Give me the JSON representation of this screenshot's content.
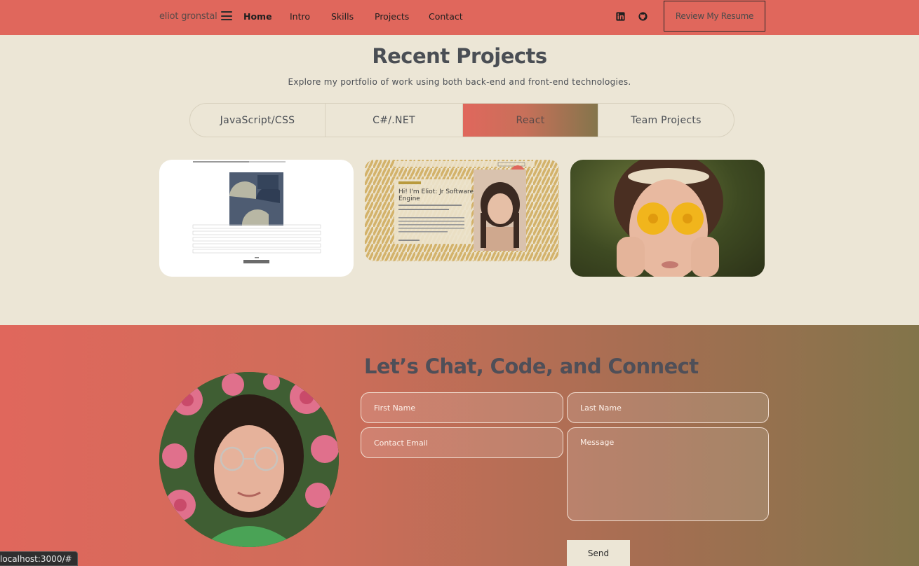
{
  "nav": {
    "brand": "eliot gronstal",
    "links": [
      "Home",
      "Intro",
      "Skills",
      "Projects",
      "Contact"
    ],
    "active": "Home",
    "icons": [
      "linkedin-icon",
      "github-icon"
    ],
    "resume_label": "Review My Resume"
  },
  "projects": {
    "title": "Recent Projects",
    "subtitle": "Explore my portfolio of work using both back-end and front-end technologies.",
    "tabs": [
      "JavaScript/CSS",
      "C#/.NET",
      "React",
      "Team Projects"
    ],
    "active_tab": "React",
    "cards": {
      "card2_heading": "Hi! I'm Eliot: Jr Software Engine"
    }
  },
  "contact": {
    "title": "Let’s Chat, Code, and Connect",
    "first_name_placeholder": "First Name",
    "last_name_placeholder": "Last Name",
    "email_placeholder": "Contact Email",
    "message_placeholder": "Message",
    "send_label": "Send"
  },
  "status_bar": {
    "url": "localhost:3000/#"
  },
  "colors": {
    "accent": "#e0675c",
    "olive": "#82744a",
    "cream": "#ece6d6"
  }
}
